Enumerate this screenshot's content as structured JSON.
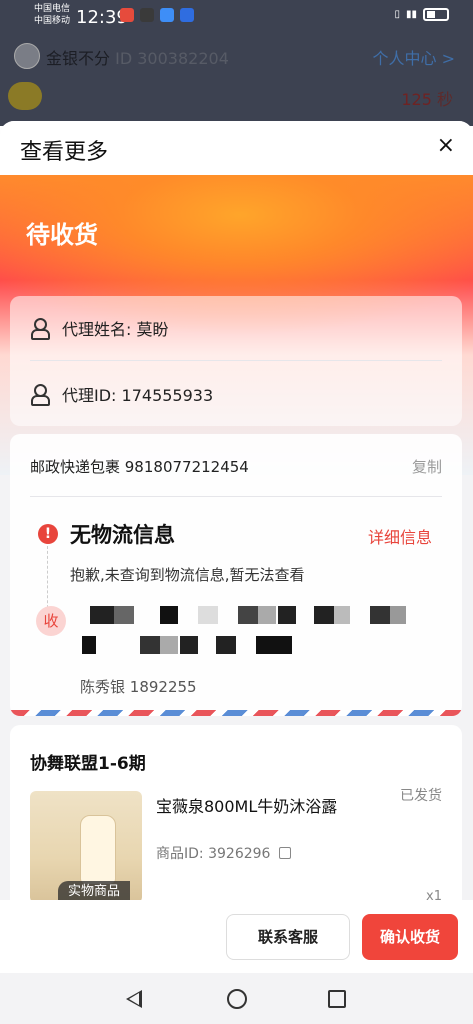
{
  "status_bar": {
    "carrier1": "中国电信",
    "carrier2": "中国移动",
    "time": "12:39",
    "app_icon_colors": [
      "#e64b3c",
      "#3a3a3a",
      "#3e8ef7",
      "#2f6de0"
    ],
    "right_icons": [
      "vibrate-icon",
      "wifi-icon",
      "signal-icon",
      "battery-icon"
    ]
  },
  "user_bar": {
    "name": "金银不分",
    "id_label": "ID",
    "id": "300382204",
    "center_label": "个人中心",
    "center_chevron": ">"
  },
  "background": {
    "timer_value": "125",
    "timer_unit": "秒"
  },
  "sheet": {
    "title": "查看更多",
    "close": "×",
    "order_status": "待收货",
    "agent": {
      "name_label": "代理姓名:",
      "name": "莫盼",
      "id_label": "代理ID:",
      "id": "174555933"
    },
    "shipping": {
      "express": "邮政快递包裹 9818077212454",
      "copy": "复制",
      "alert_mark": "!",
      "no_info_title": "无物流信息",
      "detail_link": "详细信息",
      "no_info_desc": "抱歉,未查询到物流信息,暂无法查看",
      "receiver_badge": "收",
      "receiver_name": "陈秀银",
      "receiver_phone": "1892255"
    },
    "goods": {
      "shop": "协舞联盟1-6期",
      "image_tag": "实物商品",
      "name": "宝薇泉800ML牛奶沐浴露",
      "status": "已发货",
      "id_label": "商品ID:",
      "id": "3926296",
      "quantity": "x1"
    },
    "actions": {
      "customer_service": "联系客服",
      "confirm": "确认收货"
    },
    "accent_color": "#f0453b"
  }
}
